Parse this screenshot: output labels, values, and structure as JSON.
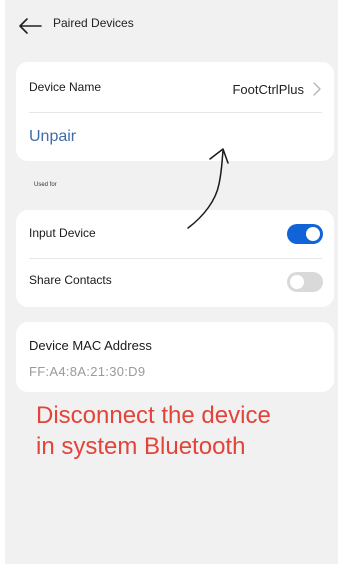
{
  "header": {
    "title": "Paired Devices",
    "back_icon": "arrow-left-icon"
  },
  "device_card": {
    "name_label": "Device Name",
    "name_value": "FootCtrlPlus",
    "chevron_icon": "chevron-right-icon",
    "unpair_label": "Unpair"
  },
  "used_for": {
    "section_label": "Used for",
    "input_device": {
      "label": "Input Device",
      "enabled": true
    },
    "share_contacts": {
      "label": "Share Contacts",
      "enabled": false
    }
  },
  "mac_card": {
    "label": "Device MAC Address",
    "value": "FF:A4:8A:21:30:D9"
  },
  "annotation": {
    "line1": "Disconnect the device",
    "line2": "in system Bluetooth",
    "arrow_icon": "hand-drawn-arrow-icon"
  },
  "colors": {
    "accent": "#1064d8",
    "link": "#3f6da8",
    "annotation": "#e2443a",
    "background": "#f1f1f1"
  }
}
